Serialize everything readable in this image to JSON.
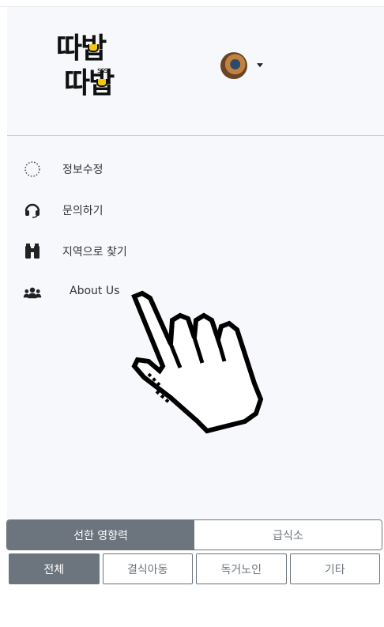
{
  "logo": {
    "line1": "따밥",
    "line2": "따밥",
    "steam": "sss"
  },
  "header": {
    "avatar_caret": "▾"
  },
  "menu": {
    "items": [
      {
        "label": "정보수정",
        "icon": "dotted-circle-icon"
      },
      {
        "label": "문의하기",
        "icon": "headset-icon"
      },
      {
        "label": "지역으로 찾기",
        "icon": "binoculars-icon"
      },
      {
        "label": "About Us",
        "icon": "users-icon"
      }
    ]
  },
  "tabs_primary": [
    {
      "label": "선한 영향력",
      "active": true
    },
    {
      "label": "급식소",
      "active": false
    }
  ],
  "tabs_secondary": [
    {
      "label": "전체",
      "active": true
    },
    {
      "label": "결식아동",
      "active": false
    },
    {
      "label": "독거노인",
      "active": false
    },
    {
      "label": "기타",
      "active": false
    }
  ],
  "colors": {
    "accent": "#6c757d",
    "logo_yellow": "#f3c80f",
    "sidebar_bg": "#f7f8fb"
  }
}
